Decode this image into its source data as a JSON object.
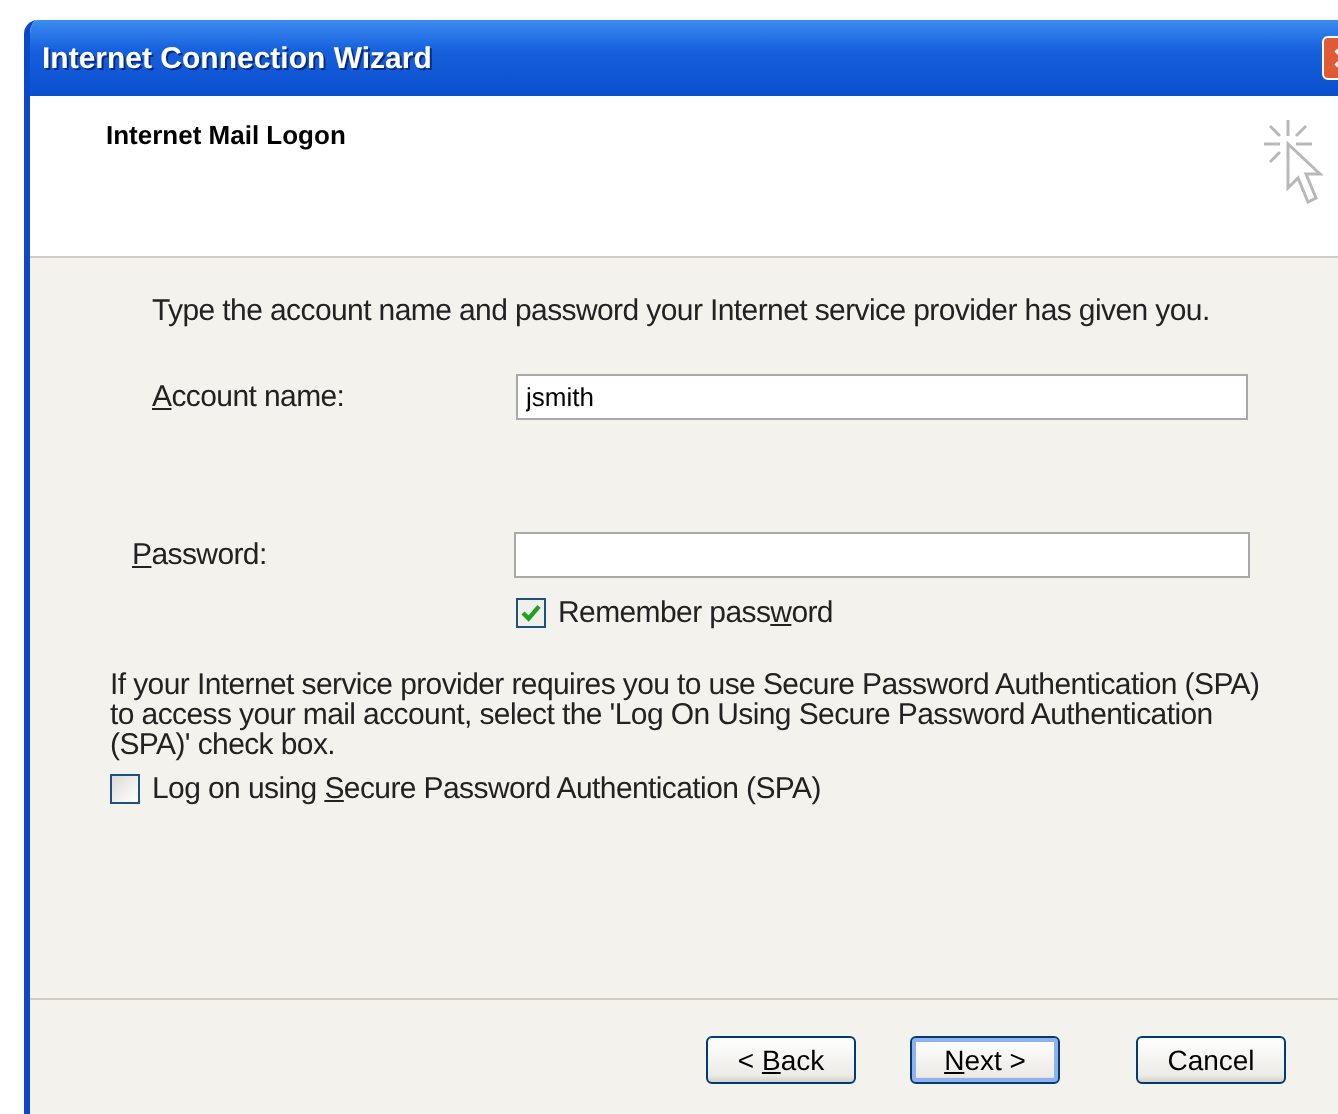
{
  "window": {
    "title": "Internet Connection Wizard"
  },
  "header": {
    "title": "Internet Mail Logon"
  },
  "intro": "Type the account name and password your Internet service provider has given you.",
  "fields": [
    {
      "label": {
        "key": "A",
        "after": "ccount name:"
      },
      "value": "jsmith"
    },
    {
      "label": {
        "key": "P",
        "after": "assword:"
      }
    }
  ],
  "remember_password": {
    "label": {
      "before": "Remember pass",
      "key": "w",
      "after": "ord"
    },
    "checked": true
  },
  "spa_note": "If your Internet service provider requires you to use Secure Password Authentication (SPA) to access your mail account, select the 'Log On Using Secure Password Authentication (SPA)' check box.",
  "spa": {
    "label": {
      "before": "Log on using ",
      "key": "S",
      "after": "ecure Password Authentication (SPA)"
    },
    "checked": false
  },
  "buttons": [
    {
      "label": {
        "before": "< ",
        "key": "B",
        "after": "ack"
      },
      "default": false
    },
    {
      "label": {
        "key": "N",
        "after": "ext >"
      },
      "default": true
    },
    {
      "label": {
        "before": "Cancel"
      },
      "default": false
    }
  ]
}
